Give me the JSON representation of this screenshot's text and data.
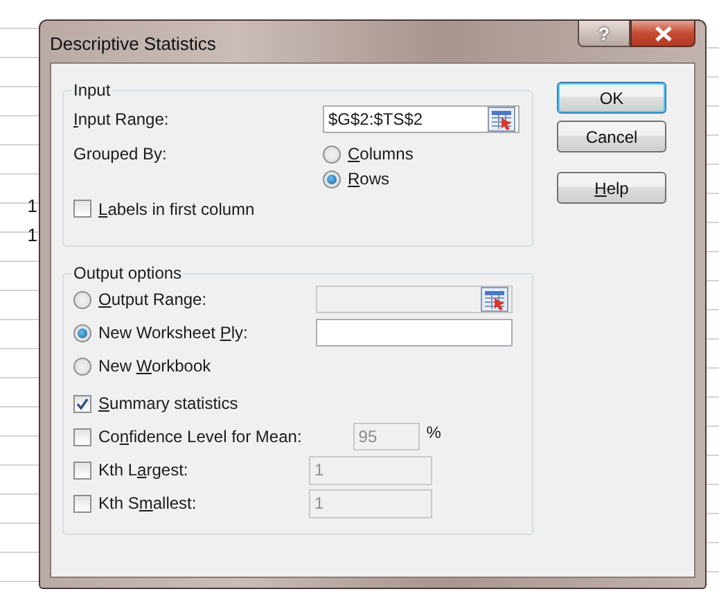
{
  "sheet": {
    "left_cells": [
      "1",
      "1"
    ]
  },
  "window": {
    "title": "Descriptive Statistics",
    "help_button": "?"
  },
  "input": {
    "legend": "Input",
    "range": {
      "label": [
        {
          "key": "I"
        },
        "nput Range:"
      ],
      "value": "$G$2:$TS$2"
    },
    "grouped_by": {
      "label": [
        "Grouped By:"
      ],
      "options": [
        {
          "label": [
            {
              "key": "C"
            },
            "olumns"
          ],
          "selected": false
        },
        {
          "label": [
            {
              "key": "R"
            },
            "ows"
          ],
          "selected": true
        }
      ]
    },
    "labels_option": {
      "label": [
        {
          "key": "L"
        },
        "abels in first column"
      ],
      "checked": false
    }
  },
  "output": {
    "legend": "Output options",
    "destinations": [
      {
        "kind": "range",
        "label": [
          {
            "key": "O"
          },
          "utput Range:"
        ],
        "selected": false
      },
      {
        "kind": "field",
        "label": [
          "New Worksheet ",
          {
            "key": "P"
          },
          "ly:"
        ],
        "selected": true
      },
      {
        "kind": "plain",
        "label": [
          "New ",
          {
            "key": "W"
          },
          "orkbook"
        ],
        "selected": false
      }
    ],
    "options": [
      {
        "kind": "plain",
        "label": [
          {
            "key": "S"
          },
          "ummary statistics"
        ],
        "checked": true
      },
      {
        "kind": "percent",
        "label": [
          "Co",
          {
            "key": "n"
          },
          "fidence Level for Mean:"
        ],
        "checked": false,
        "value": "95",
        "unit": "%"
      },
      {
        "kind": "number",
        "label": [
          "Kth L",
          {
            "key": "a"
          },
          "rgest:"
        ],
        "checked": false,
        "value": "1"
      },
      {
        "kind": "number",
        "label": [
          "Kth S",
          {
            "key": "m"
          },
          "allest:"
        ],
        "checked": false,
        "value": "1"
      }
    ]
  },
  "buttons": [
    {
      "label": [
        "OK"
      ],
      "default": true
    },
    {
      "label": [
        "Cancel"
      ],
      "default": false
    },
    {
      "label": [
        {
          "key": "H"
        },
        "elp"
      ],
      "default": false
    }
  ]
}
